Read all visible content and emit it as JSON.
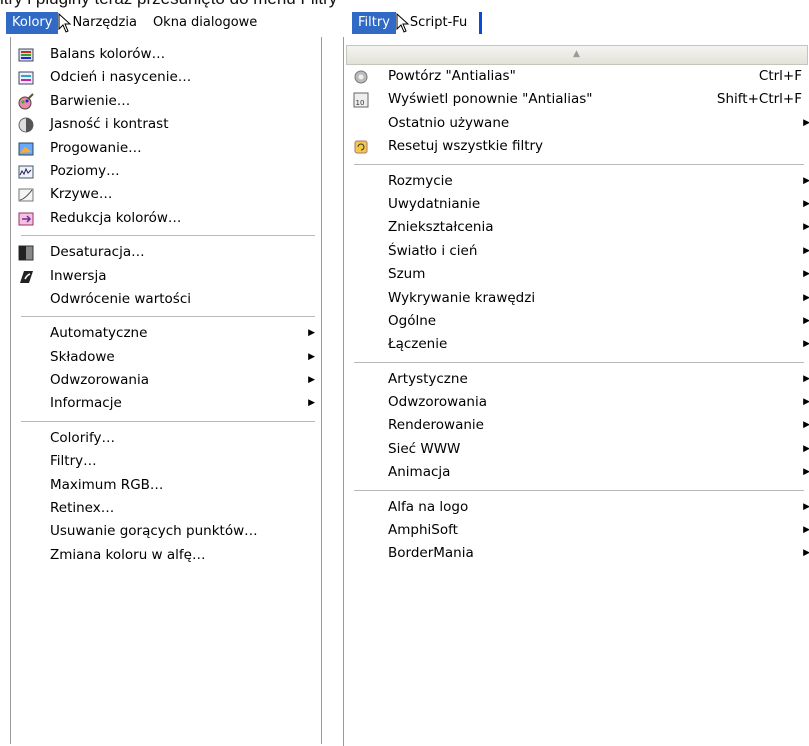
{
  "caption": "ltry i pluginy teraz przesunięto do menu Filtry",
  "left_menubar": [
    {
      "label": "Kolory",
      "active": true
    },
    {
      "label": "Narzędzia",
      "active": false
    },
    {
      "label": "Okna dialogowe",
      "active": false
    }
  ],
  "right_menubar": [
    {
      "label": "Filtry",
      "active": true
    },
    {
      "label": "Script-Fu",
      "active": false
    }
  ],
  "kolory_menu": {
    "items": [
      {
        "label": "Balans kolorów…",
        "icon": "color-balance-icon"
      },
      {
        "label": "Odcień i nasycenie…",
        "icon": "hue-saturation-icon"
      },
      {
        "label": "Barwienie…",
        "icon": "colorize-icon"
      },
      {
        "label": "Jasność i kontrast",
        "icon": "brightness-contrast-icon"
      },
      {
        "label": "Progowanie…",
        "icon": "threshold-icon"
      },
      {
        "label": "Poziomy…",
        "icon": "levels-icon"
      },
      {
        "label": "Krzywe…",
        "icon": "curves-icon"
      },
      {
        "label": "Redukcja kolorów…",
        "icon": "posterize-icon"
      },
      {
        "separator": true
      },
      {
        "label": "Desaturacja…",
        "icon": "desaturate-icon"
      },
      {
        "label": "Inwersja",
        "icon": "invert-icon"
      },
      {
        "label": "Odwrócenie wartości"
      },
      {
        "separator": true
      },
      {
        "label": "Automatyczne",
        "submenu": true
      },
      {
        "label": "Składowe",
        "submenu": true
      },
      {
        "label": "Odwzorowania",
        "submenu": true
      },
      {
        "label": "Informacje",
        "submenu": true
      },
      {
        "separator": true
      },
      {
        "label": "Colorify…"
      },
      {
        "label": "Filtry…"
      },
      {
        "label": "Maximum RGB…"
      },
      {
        "label": "Retinex…"
      },
      {
        "label": "Usuwanie gorących punktów…"
      },
      {
        "label": "Zmiana koloru w alfę…"
      }
    ]
  },
  "filtry_menu": {
    "scroll_up_icon": "scroll-up-arrow-icon",
    "items": [
      {
        "label": "Powtórz \"Antialias\"",
        "icon": "repeat-filter-icon",
        "shortcut": "Ctrl+F"
      },
      {
        "label": "Wyświetl ponownie \"Antialias\"",
        "icon": "reshow-filter-icon",
        "shortcut": "Shift+Ctrl+F"
      },
      {
        "label": "Ostatnio używane",
        "submenu": true
      },
      {
        "label": "Resetuj wszystkie filtry",
        "icon": "reset-filters-icon"
      },
      {
        "separator": true
      },
      {
        "label": "Rozmycie",
        "submenu": true
      },
      {
        "label": "Uwydatnianie",
        "submenu": true
      },
      {
        "label": "Zniekształcenia",
        "submenu": true
      },
      {
        "label": "Światło i cień",
        "submenu": true
      },
      {
        "label": "Szum",
        "submenu": true
      },
      {
        "label": "Wykrywanie krawędzi",
        "submenu": true
      },
      {
        "label": "Ogólne",
        "submenu": true
      },
      {
        "label": "Łączenie",
        "submenu": true
      },
      {
        "separator": true
      },
      {
        "label": "Artystyczne",
        "submenu": true
      },
      {
        "label": "Odwzorowania",
        "submenu": true
      },
      {
        "label": "Renderowanie",
        "submenu": true
      },
      {
        "label": "Sieć WWW",
        "submenu": true
      },
      {
        "label": "Animacja",
        "submenu": true
      },
      {
        "separator": true
      },
      {
        "label": "Alfa na logo",
        "submenu": true
      },
      {
        "label": "AmphiSoft",
        "submenu": true
      },
      {
        "label": "BorderMania",
        "submenu": true
      }
    ]
  },
  "colors": {
    "menu_highlight": "#316ac5",
    "menu_border": "#9a9a9a",
    "separator": "#b8b8b8"
  }
}
